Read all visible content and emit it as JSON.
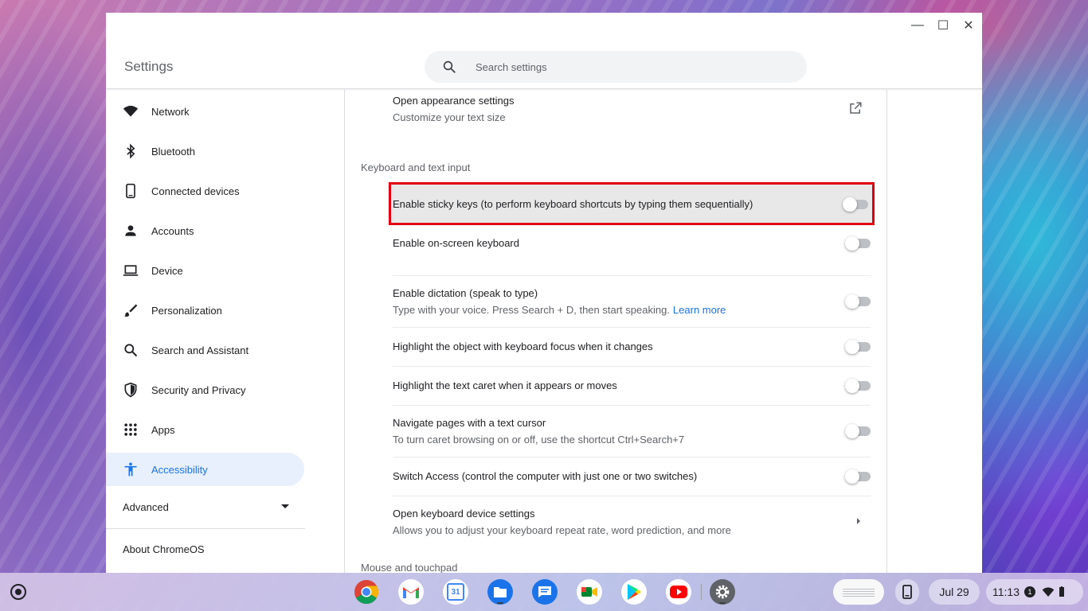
{
  "window": {
    "title": "Settings",
    "controls": {
      "minimize": "—",
      "maximize": "☐",
      "close": "✕"
    }
  },
  "search": {
    "placeholder": "Search settings",
    "value": ""
  },
  "sidebar": {
    "items": [
      {
        "label": "Network",
        "icon": "wifi-icon"
      },
      {
        "label": "Bluetooth",
        "icon": "bluetooth-icon"
      },
      {
        "label": "Connected devices",
        "icon": "phone-icon"
      },
      {
        "label": "Accounts",
        "icon": "person-icon"
      },
      {
        "label": "Device",
        "icon": "laptop-icon"
      },
      {
        "label": "Personalization",
        "icon": "brush-icon"
      },
      {
        "label": "Search and Assistant",
        "icon": "search-icon"
      },
      {
        "label": "Security and Privacy",
        "icon": "shield-icon"
      },
      {
        "label": "Apps",
        "icon": "apps-grid-icon"
      },
      {
        "label": "Accessibility",
        "icon": "accessibility-icon",
        "active": true
      }
    ],
    "advanced_label": "Advanced",
    "about_label": "About ChromeOS"
  },
  "main": {
    "appearance": {
      "title": "Open appearance settings",
      "subtitle": "Customize your text size"
    },
    "keyboard_section": "Keyboard and text input",
    "rows": [
      {
        "title": "Enable sticky keys (to perform keyboard shortcuts by typing them sequentially)",
        "enabled": false
      },
      {
        "title": "Enable on-screen keyboard",
        "enabled": false
      },
      {
        "title": "Enable dictation (speak to type)",
        "subtitle": "Type with your voice. Press Search + D, then start speaking.",
        "link": "Learn more",
        "enabled": false
      },
      {
        "title": "Highlight the object with keyboard focus when it changes",
        "enabled": false
      },
      {
        "title": "Highlight the text caret when it appears or moves",
        "enabled": false
      },
      {
        "title": "Navigate pages with a text cursor",
        "subtitle": "To turn caret browsing on or off, use the shortcut Ctrl+Search+7",
        "enabled": false
      },
      {
        "title": "Switch Access (control the computer with just one or two switches)",
        "enabled": false
      }
    ],
    "keyboard_device": {
      "title": "Open keyboard device settings",
      "subtitle": "Allows you to adjust your keyboard repeat rate, word prediction, and more"
    },
    "mouse_section": "Mouse and touchpad"
  },
  "shelf": {
    "apps": [
      "chrome-icon",
      "gmail-icon",
      "calendar-icon",
      "files-icon",
      "messages-icon",
      "meet-icon",
      "play-store-icon",
      "youtube-icon",
      "settings-icon"
    ],
    "calendar_day": "31",
    "date": "Jul 29",
    "time": "11:13",
    "notification_count": "1"
  },
  "colors": {
    "accent": "#1a73e8",
    "highlight_border": "#e0000f",
    "active_nav_bg": "#e8f0fe"
  }
}
